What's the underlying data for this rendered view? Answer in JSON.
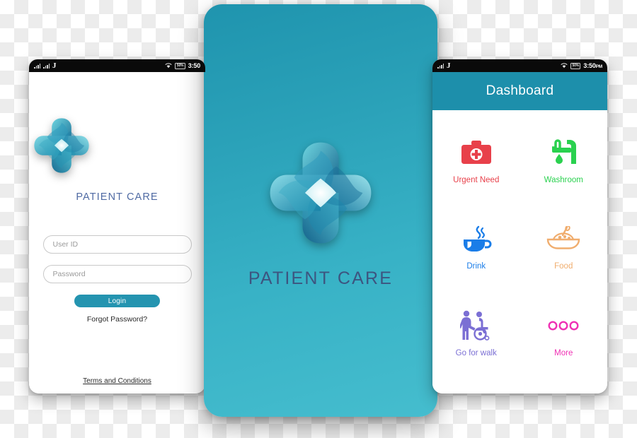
{
  "statusbar": {
    "carrier": "J",
    "battery": "50%",
    "time": "3:50",
    "ampm": "PM",
    "time_full": "3:50 PM",
    "icons": [
      "signal-bars-icon",
      "signal-bars-icon",
      "wifi-icon",
      "battery-icon"
    ]
  },
  "login_screen": {
    "logo_name": "patient-care-logo",
    "app_title": "PATIENT CARE",
    "title_color": "#4f6aa3",
    "userid": {
      "value": "",
      "placeholder": "User ID"
    },
    "password": {
      "value": "",
      "placeholder": "Password"
    },
    "login_label": "Login",
    "login_color": "#2494b0",
    "forgot_label": "Forgot Password?",
    "terms_label": "Terms  and Conditions"
  },
  "splash_screen": {
    "logo_name": "patient-care-logo",
    "app_title": "PATIENT CARE",
    "title_color": "#3d5580",
    "bg_top": "#1f94ae",
    "bg_bottom": "#45bdce"
  },
  "dashboard_screen": {
    "header_title": "Dashboard",
    "header_color": "#1d8fab",
    "tiles": [
      {
        "label": "Urgent Need",
        "icon": "first-aid-kit-icon",
        "color": "#e8404a"
      },
      {
        "label": "Washroom",
        "icon": "faucet-water-icon",
        "color": "#2ad14f"
      },
      {
        "label": "Drink",
        "icon": "coffee-cup-icon",
        "color": "#1a7de8"
      },
      {
        "label": "Food",
        "icon": "food-bowl-icon",
        "color": "#f0ad6e"
      },
      {
        "label": "Go for walk",
        "icon": "wheelchair-assist-icon",
        "color": "#7b6fd4"
      },
      {
        "label": "More",
        "icon": "three-dots-icon",
        "color": "#ef31b4"
      }
    ]
  }
}
